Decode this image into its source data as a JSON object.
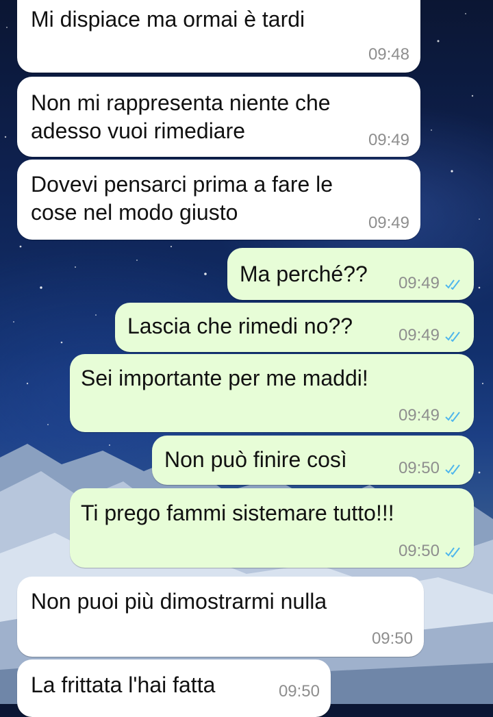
{
  "theme": {
    "incoming_bubble": "#ffffff",
    "outgoing_bubble": "#e7fdd7",
    "tick_color": "#4fb6ec",
    "time_color": "#8e8e8e"
  },
  "messages": [
    {
      "direction": "incoming",
      "lines": [
        "Mi dispiace ma ormai è tardi"
      ],
      "time": "09:48"
    },
    {
      "direction": "incoming",
      "lines": [
        "Non mi rappresenta niente che",
        "adesso vuoi rimediare"
      ],
      "time": "09:49"
    },
    {
      "direction": "incoming",
      "lines": [
        "Dovevi pensarci prima a fare le",
        "cose nel modo giusto"
      ],
      "time": "09:49"
    },
    {
      "direction": "outgoing",
      "lines": [
        "Ma perché??"
      ],
      "time": "09:49",
      "status_icon": "double-check-icon"
    },
    {
      "direction": "outgoing",
      "lines": [
        "Lascia che rimedi no??"
      ],
      "time": "09:49",
      "status_icon": "double-check-icon"
    },
    {
      "direction": "outgoing",
      "lines": [
        "Sei importante per me maddi!"
      ],
      "time": "09:49",
      "status_icon": "double-check-icon"
    },
    {
      "direction": "outgoing",
      "lines": [
        "Non può finire così"
      ],
      "time": "09:50",
      "status_icon": "double-check-icon"
    },
    {
      "direction": "outgoing",
      "lines": [
        "Ti prego fammi sistemare tutto!!!"
      ],
      "time": "09:50",
      "status_icon": "double-check-icon"
    },
    {
      "direction": "incoming",
      "lines": [
        "Non puoi più dimostrarmi nulla"
      ],
      "time": "09:50"
    },
    {
      "direction": "incoming",
      "lines": [
        "La frittata l'hai fatta"
      ],
      "time": "09:50"
    }
  ]
}
